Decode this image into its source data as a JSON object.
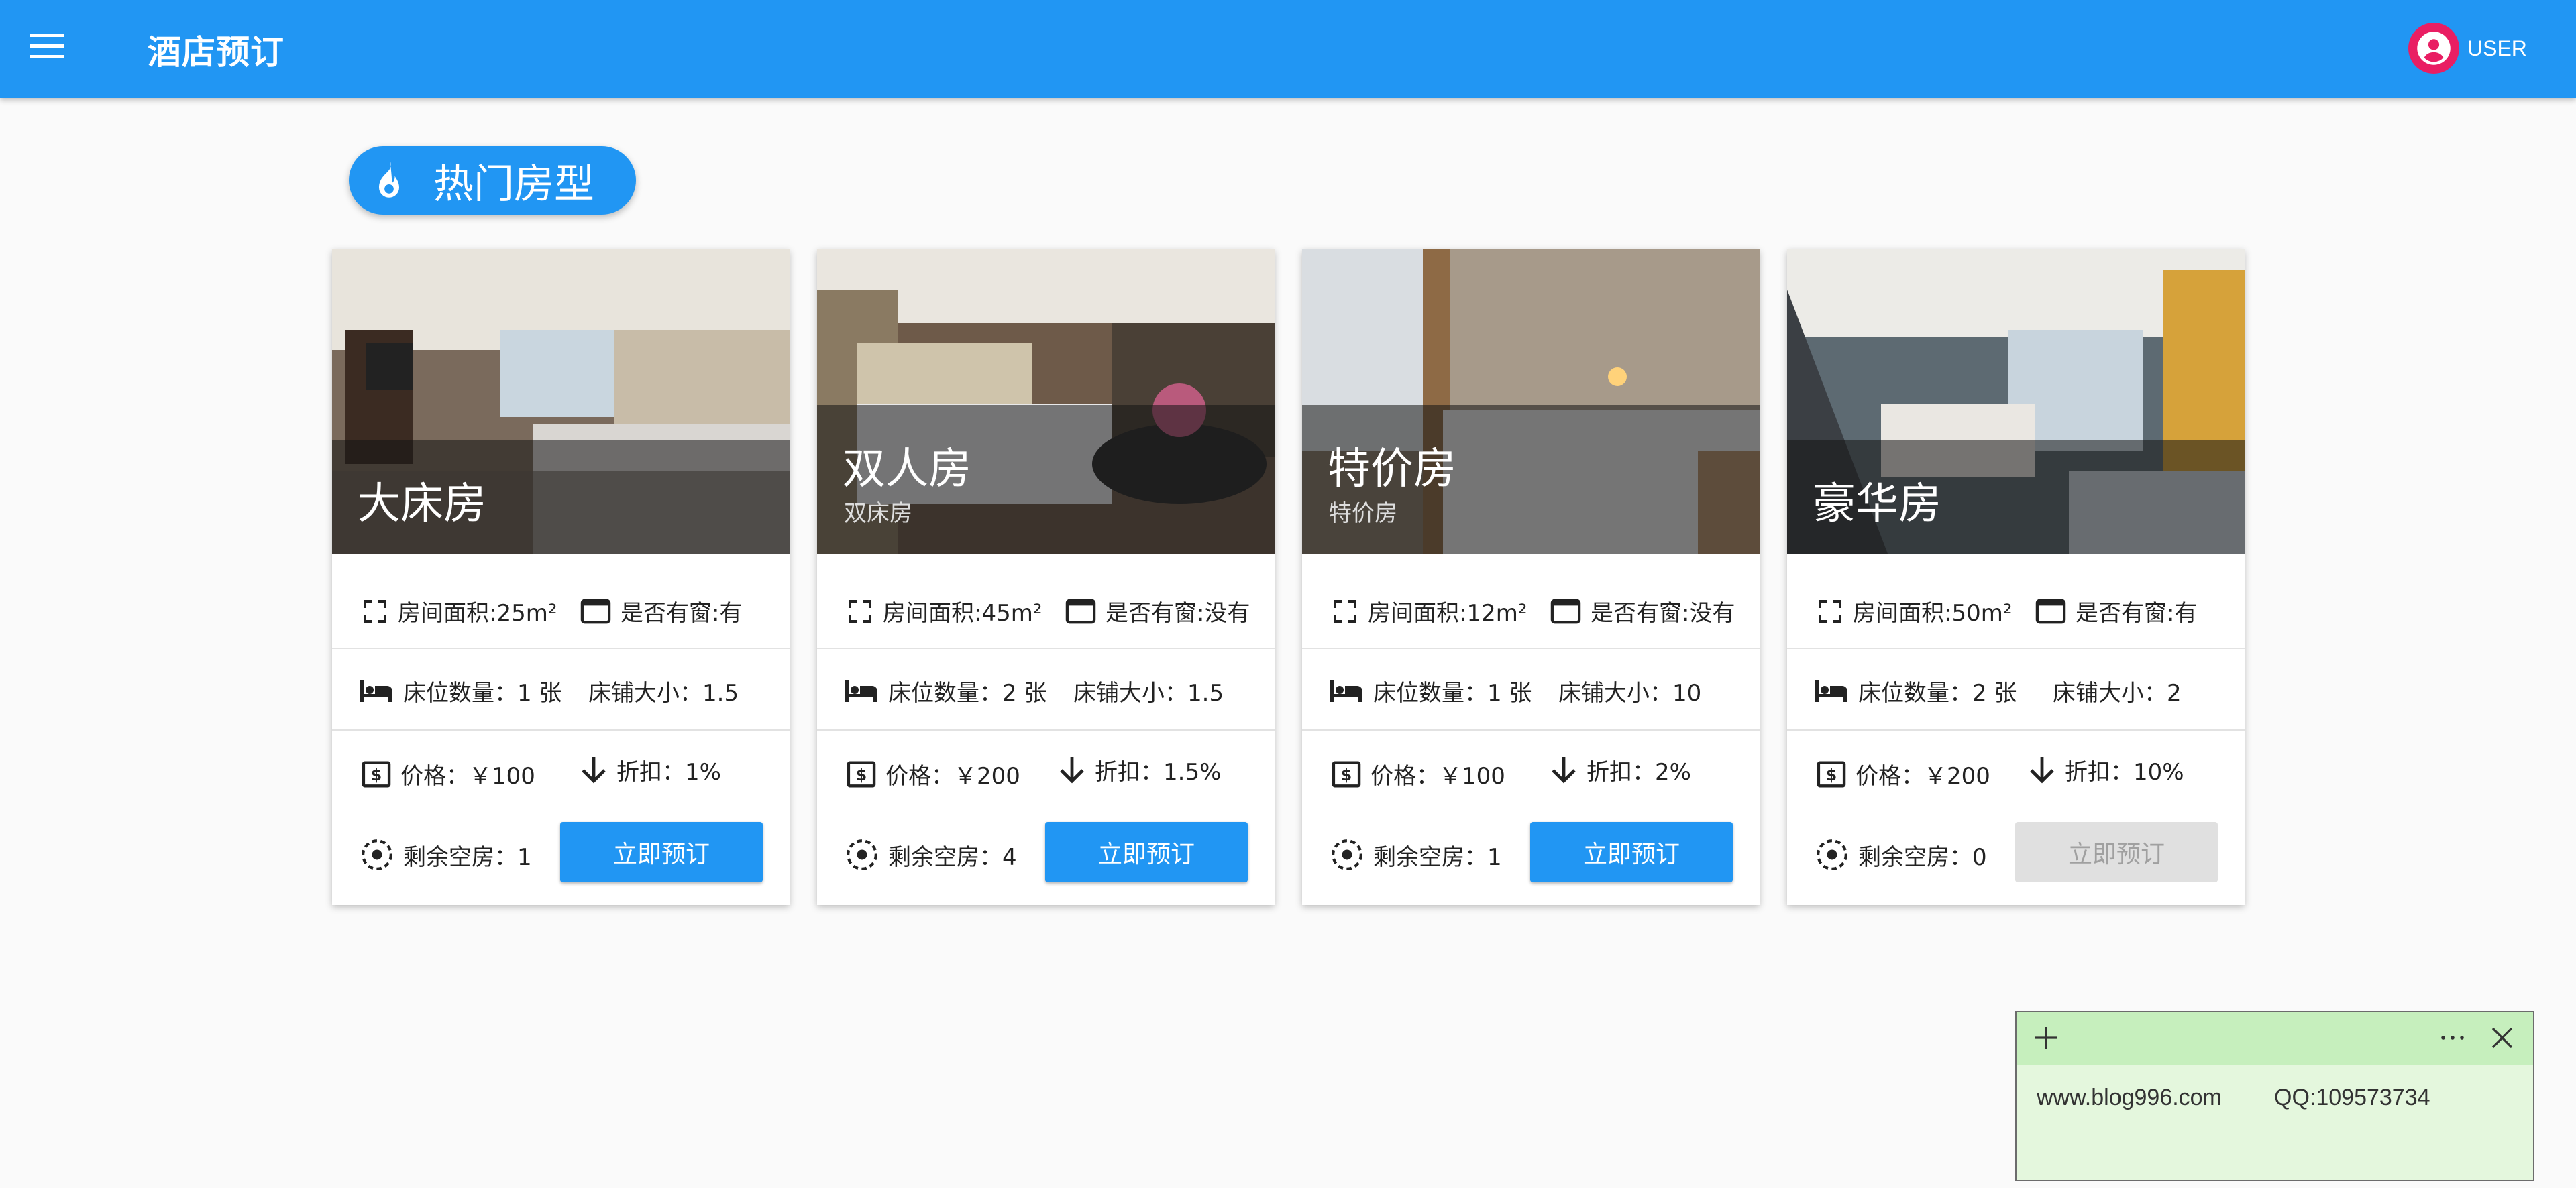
{
  "app": {
    "title": "酒店预订",
    "user_label": "USER"
  },
  "section": {
    "title": "热门房型"
  },
  "rooms": [
    {
      "name": "大床房",
      "subtitle": "",
      "area": "房间面积:25m²",
      "window": "是否有窗:有",
      "bed_count": "床位数量：1 张",
      "bed_size": "床铺大小：1.5",
      "price": "价格：￥100",
      "discount": "折扣：1%",
      "vacancy": "剩余空房：1",
      "book_label": "立即预订",
      "book_enabled": true
    },
    {
      "name": "双人房",
      "subtitle": "双床房",
      "area": "房间面积:45m²",
      "window": "是否有窗:没有",
      "bed_count": "床位数量：2 张",
      "bed_size": "床铺大小：1.5",
      "price": "价格：￥200",
      "discount": "折扣：1.5%",
      "vacancy": "剩余空房：4",
      "book_label": "立即预订",
      "book_enabled": true
    },
    {
      "name": "特价房",
      "subtitle": "特价房",
      "area": "房间面积:12m²",
      "window": "是否有窗:没有",
      "bed_count": "床位数量：1 张",
      "bed_size": "床铺大小：10",
      "price": "价格：￥100",
      "discount": "折扣：2%",
      "vacancy": "剩余空房：1",
      "book_label": "立即预订",
      "book_enabled": true
    },
    {
      "name": "豪华房",
      "subtitle": "",
      "area": "房间面积:50m²",
      "window": "是否有窗:有",
      "bed_count": "床位数量：2 张",
      "bed_size": "床铺大小：2",
      "price": "价格：￥200",
      "discount": "折扣：10%",
      "vacancy": "剩余空房：0",
      "book_label": "立即预订",
      "book_enabled": false
    }
  ],
  "note": {
    "site": "www.blog996.com",
    "qq": "QQ:109573734"
  },
  "colors": {
    "primary": "#2196f3",
    "accent": "#e91e63",
    "note_bg": "#e4f7dd",
    "note_bar": "#c6efbd"
  }
}
